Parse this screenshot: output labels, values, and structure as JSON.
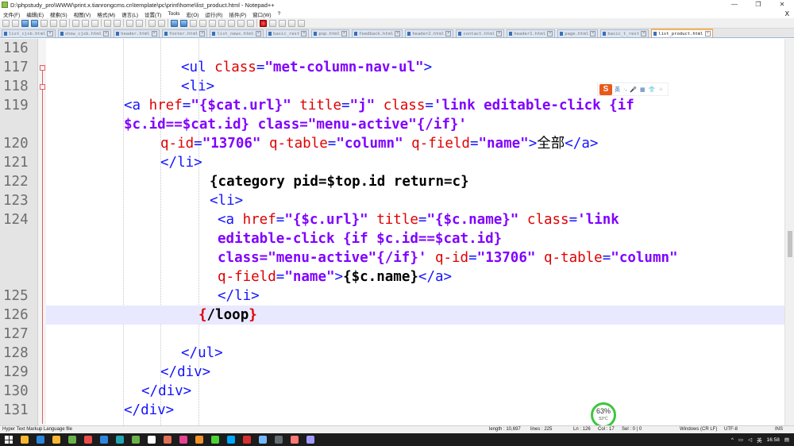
{
  "window": {
    "title": "D:\\phpstudy_pro\\WWW\\print.x.tianrongcms.cn\\template\\pc\\print\\home\\list_product.html - Notepad++",
    "controls": [
      "—",
      "❐",
      "✕"
    ]
  },
  "menu": {
    "items": [
      "文件(F)",
      "编辑(E)",
      "搜索(S)",
      "视图(V)",
      "格式(M)",
      "语言(L)",
      "设置(T)",
      "Tools",
      "宏(O)",
      "运行(R)",
      "插件(P)",
      "窗口(W)",
      "?"
    ],
    "close": "X"
  },
  "tabs": [
    {
      "label": "list_cjsb.html"
    },
    {
      "label": "show_cjsb.html"
    },
    {
      "label": "header.html"
    },
    {
      "label": "footer.html"
    },
    {
      "label": "list_news.html"
    },
    {
      "label": "basic_rest"
    },
    {
      "label": "pop.html"
    },
    {
      "label": "feedback.html"
    },
    {
      "label": "header2.html"
    },
    {
      "label": "contact.html"
    },
    {
      "label": "header1.html"
    },
    {
      "label": "page.html"
    },
    {
      "label": "basic_t_rest"
    },
    {
      "label": "list_product.html"
    }
  ],
  "editor": {
    "lines": [
      {
        "num": "116",
        "segments": []
      },
      {
        "num": "117",
        "segments": [
          [
            "t-tag",
            "<ul "
          ],
          [
            "t-attr",
            "class"
          ],
          [
            "t-tag",
            "="
          ],
          [
            "t-str",
            "\"met-column-nav-ul\""
          ],
          [
            "t-tag",
            ">"
          ]
        ]
      },
      {
        "num": "118",
        "segments": [
          [
            "t-tag",
            "<li>"
          ]
        ]
      },
      {
        "num": "119",
        "segments": [
          [
            "t-tag",
            "<a "
          ],
          [
            "t-attr",
            "href"
          ],
          [
            "t-tag",
            "="
          ],
          [
            "t-str",
            "\"{$cat.url}\""
          ],
          [
            "t-plain",
            " "
          ],
          [
            "t-attr",
            "title"
          ],
          [
            "t-tag",
            "="
          ],
          [
            "t-str",
            "\"j\""
          ],
          [
            "t-plain",
            " "
          ],
          [
            "t-attr",
            "class"
          ],
          [
            "t-tag",
            "="
          ],
          [
            "t-str",
            "'link editable-click {if"
          ]
        ]
      },
      {
        "num": "",
        "segments": [
          [
            "t-str",
            "$c.id==$cat.id} class=\"menu-active\"{/if}'"
          ]
        ]
      },
      {
        "num": "120",
        "segments": [
          [
            "t-attr",
            "q-id"
          ],
          [
            "t-tag",
            "="
          ],
          [
            "t-str",
            "\"13706\""
          ],
          [
            "t-plain",
            " "
          ],
          [
            "t-attr",
            "q-table"
          ],
          [
            "t-tag",
            "="
          ],
          [
            "t-str",
            "\"column\""
          ],
          [
            "t-plain",
            " "
          ],
          [
            "t-attr",
            "q-field"
          ],
          [
            "t-tag",
            "="
          ],
          [
            "t-str",
            "\"name\""
          ],
          [
            "t-tag",
            ">"
          ],
          [
            "t-plain",
            "全部"
          ],
          [
            "t-tag",
            "</a>"
          ]
        ]
      },
      {
        "num": "121",
        "segments": [
          [
            "t-tag",
            "</li>"
          ]
        ]
      },
      {
        "num": "122",
        "segments": [
          [
            "t-txt",
            "{category pid=$top.id return=c}"
          ]
        ]
      },
      {
        "num": "123",
        "segments": [
          [
            "t-tag",
            "<li>"
          ]
        ]
      },
      {
        "num": "124",
        "segments": [
          [
            "t-tag",
            "<a "
          ],
          [
            "t-attr",
            "href"
          ],
          [
            "t-tag",
            "="
          ],
          [
            "t-str",
            "\"{$c.url}\""
          ],
          [
            "t-plain",
            " "
          ],
          [
            "t-attr",
            "title"
          ],
          [
            "t-tag",
            "="
          ],
          [
            "t-str",
            "\"{$c.name}\""
          ],
          [
            "t-plain",
            " "
          ],
          [
            "t-attr",
            "class"
          ],
          [
            "t-tag",
            "="
          ],
          [
            "t-str",
            "'link"
          ]
        ]
      },
      {
        "num": "",
        "segments": [
          [
            "t-str",
            "editable-click {if $c.id==$cat.id}"
          ]
        ]
      },
      {
        "num": "",
        "segments": [
          [
            "t-str",
            "class=\"menu-active\"{/if}'"
          ],
          [
            "t-plain",
            " "
          ],
          [
            "t-attr",
            "q-id"
          ],
          [
            "t-tag",
            "="
          ],
          [
            "t-str",
            "\"13706\""
          ],
          [
            "t-plain",
            " "
          ],
          [
            "t-attr",
            "q-table"
          ],
          [
            "t-tag",
            "="
          ],
          [
            "t-str",
            "\"column\""
          ]
        ]
      },
      {
        "num": "",
        "segments": [
          [
            "t-attr",
            "q-field"
          ],
          [
            "t-tag",
            "="
          ],
          [
            "t-str",
            "\"name\""
          ],
          [
            "t-tag",
            ">"
          ],
          [
            "t-txt",
            "{$c.name}"
          ],
          [
            "t-tag",
            "</a>"
          ]
        ]
      },
      {
        "num": "125",
        "segments": [
          [
            "t-tag",
            "</li>"
          ]
        ]
      },
      {
        "num": "126",
        "segments": [
          [
            "t-brace",
            "{"
          ],
          [
            "t-txt",
            "/loop"
          ],
          [
            "t-brace",
            "}"
          ]
        ]
      },
      {
        "num": "127",
        "segments": []
      },
      {
        "num": "128",
        "segments": [
          [
            "t-tag",
            "</ul>"
          ]
        ]
      },
      {
        "num": "129",
        "segments": [
          [
            "t-tag",
            "</div>"
          ]
        ]
      },
      {
        "num": "130",
        "segments": [
          [
            "t-tag",
            "</div>"
          ]
        ]
      },
      {
        "num": "131",
        "segments": [
          [
            "t-tag",
            "</div>"
          ]
        ]
      }
    ]
  },
  "ime": {
    "logo": "S",
    "items": [
      "英",
      "·,",
      "🎤",
      "▦",
      "👕",
      "⁘"
    ]
  },
  "statusbar": {
    "language": "Hyper Text Markup Language file",
    "length": "length : 10,697",
    "lines": "lines : 225",
    "ln": "Ln : 126",
    "col": "Col : 17",
    "sel": "Sel : 0 | 0",
    "eol": "Windows (CR LF)",
    "encoding": "UTF-8",
    "mode": "INS"
  },
  "cpu": {
    "percent": "63%",
    "temp": "53°C"
  },
  "taskbar": {
    "apps": [
      "#f7b731",
      "#2e86de",
      "#f7b731",
      "#6ab04c",
      "#eb4d4b",
      "#2e86de",
      "#22a6b3",
      "#6ab04c",
      "#ffffff",
      "#e17055",
      "#e84393",
      "#f0932b",
      "#4cd137",
      "#00a8ff",
      "#d63031",
      "#74b9ff",
      "#636e72",
      "#ff7675",
      "#a29bfe"
    ],
    "tray_text": "英",
    "time": "16:58"
  }
}
